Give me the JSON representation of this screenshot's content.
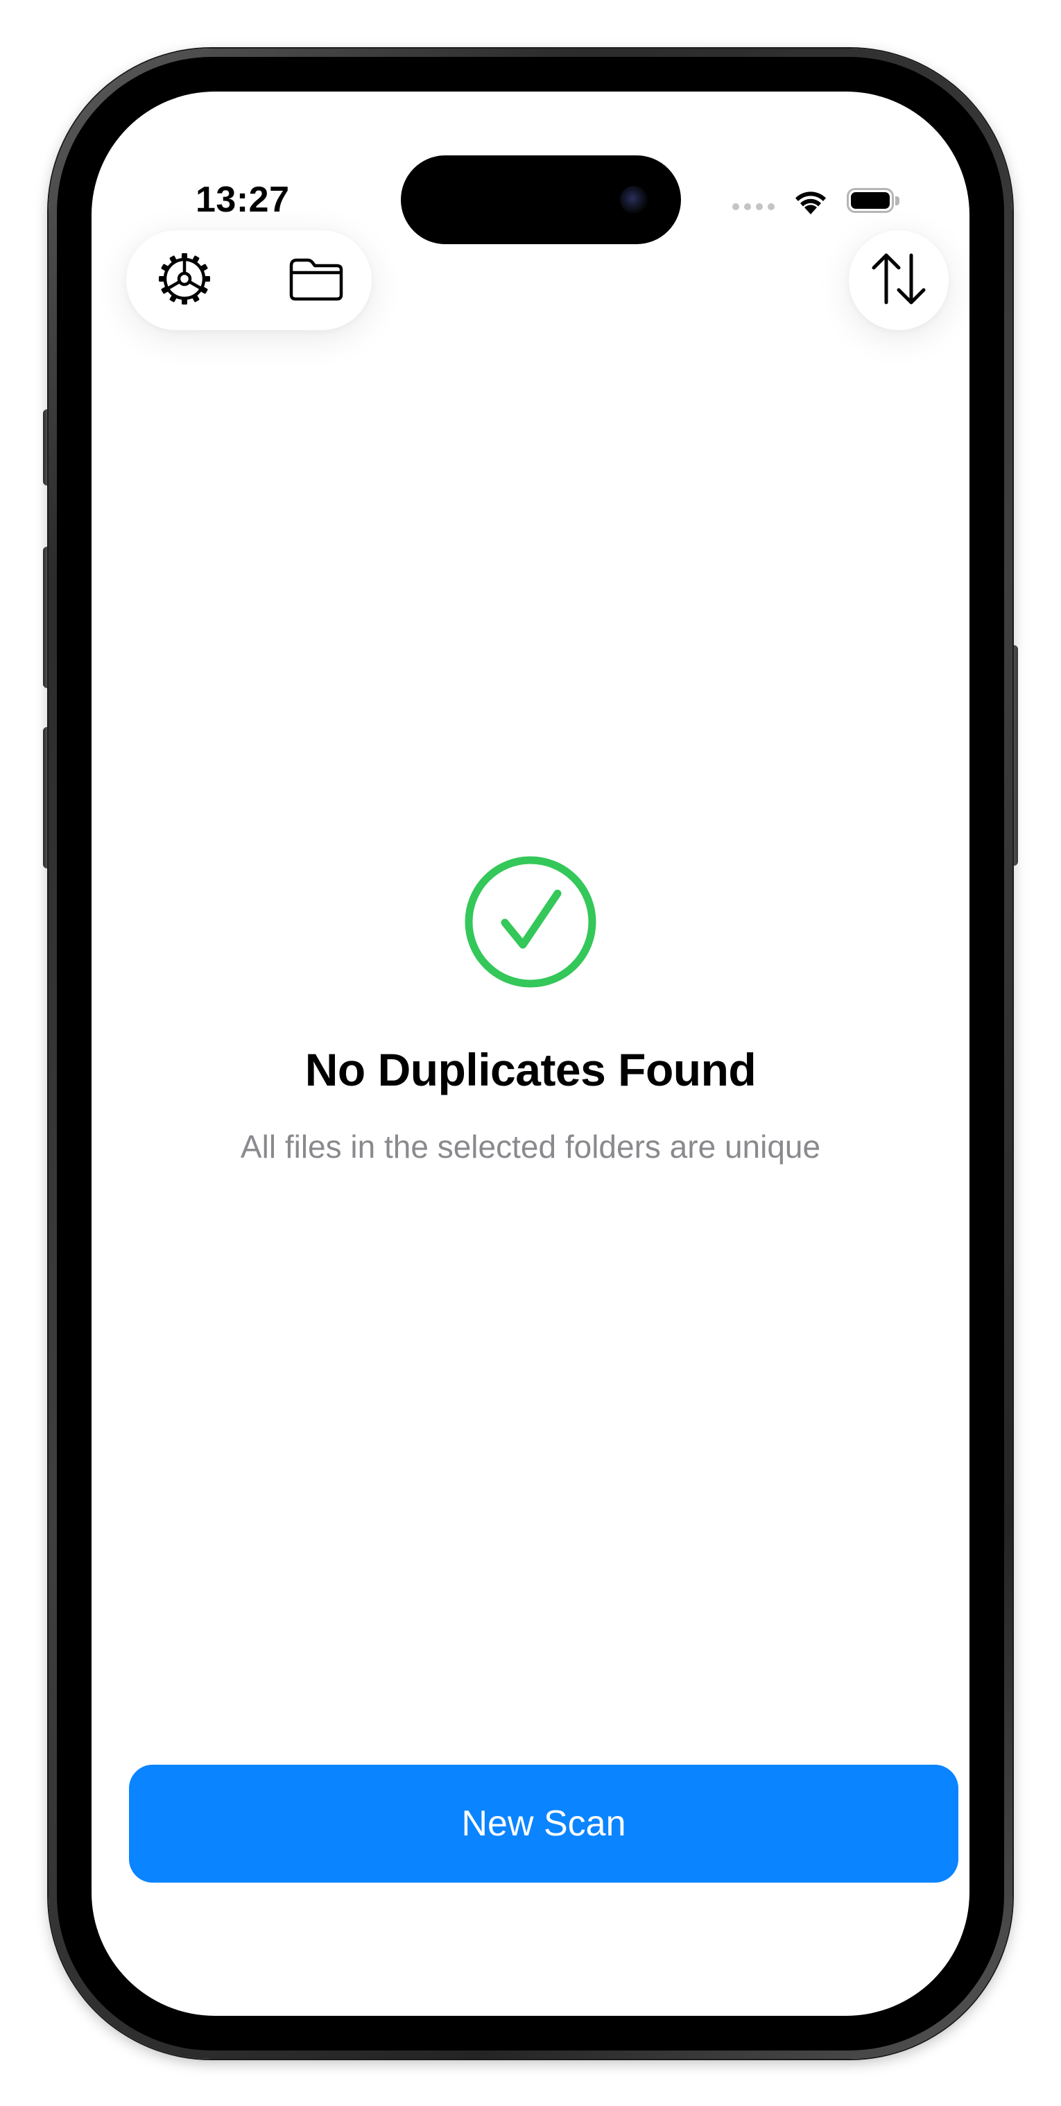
{
  "status_bar": {
    "time": "13:27",
    "icons": [
      "signal-dots-icon",
      "wifi-icon",
      "battery-icon"
    ]
  },
  "toolbar": {
    "left_icons": [
      "gear-icon",
      "folder-icon"
    ],
    "right_icon": "sort-arrows-icon"
  },
  "empty_state": {
    "icon": "checkmark-circle-icon",
    "title": "No Duplicates Found",
    "subtitle": "All files in the selected folders are unique"
  },
  "actions": {
    "new_scan_label": "New Scan"
  },
  "colors": {
    "accent": "#0a84ff",
    "success": "#34c759",
    "secondary_text": "#8a8a8e"
  }
}
